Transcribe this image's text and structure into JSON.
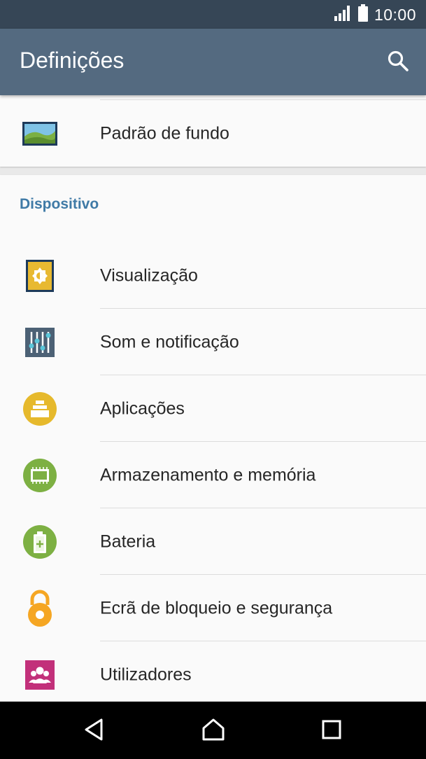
{
  "status_bar": {
    "time": "10:00",
    "icons": [
      "signal-icon",
      "battery-icon"
    ]
  },
  "app_bar": {
    "title": "Definições",
    "search_icon": "search-icon"
  },
  "top_items": [
    {
      "label": "Padrão de fundo",
      "icon": "wallpaper-icon"
    }
  ],
  "device_section": {
    "header": "Dispositivo",
    "items": [
      {
        "label": "Visualização",
        "icon": "display-icon"
      },
      {
        "label": "Som e notificação",
        "icon": "sound-icon"
      },
      {
        "label": "Aplicações",
        "icon": "apps-icon"
      },
      {
        "label": "Armazenamento e memória",
        "icon": "storage-icon"
      },
      {
        "label": "Bateria",
        "icon": "battery-setting-icon"
      },
      {
        "label": "Ecrã de bloqueio e segurança",
        "icon": "lock-icon"
      },
      {
        "label": "Utilizadores",
        "icon": "users-icon"
      }
    ]
  },
  "nav_bar": {
    "buttons": [
      "back-icon",
      "home-icon",
      "recents-icon"
    ]
  },
  "colors": {
    "status_bar": "#364656",
    "app_bar": "#546a80",
    "section_header": "#3f7aa6"
  }
}
